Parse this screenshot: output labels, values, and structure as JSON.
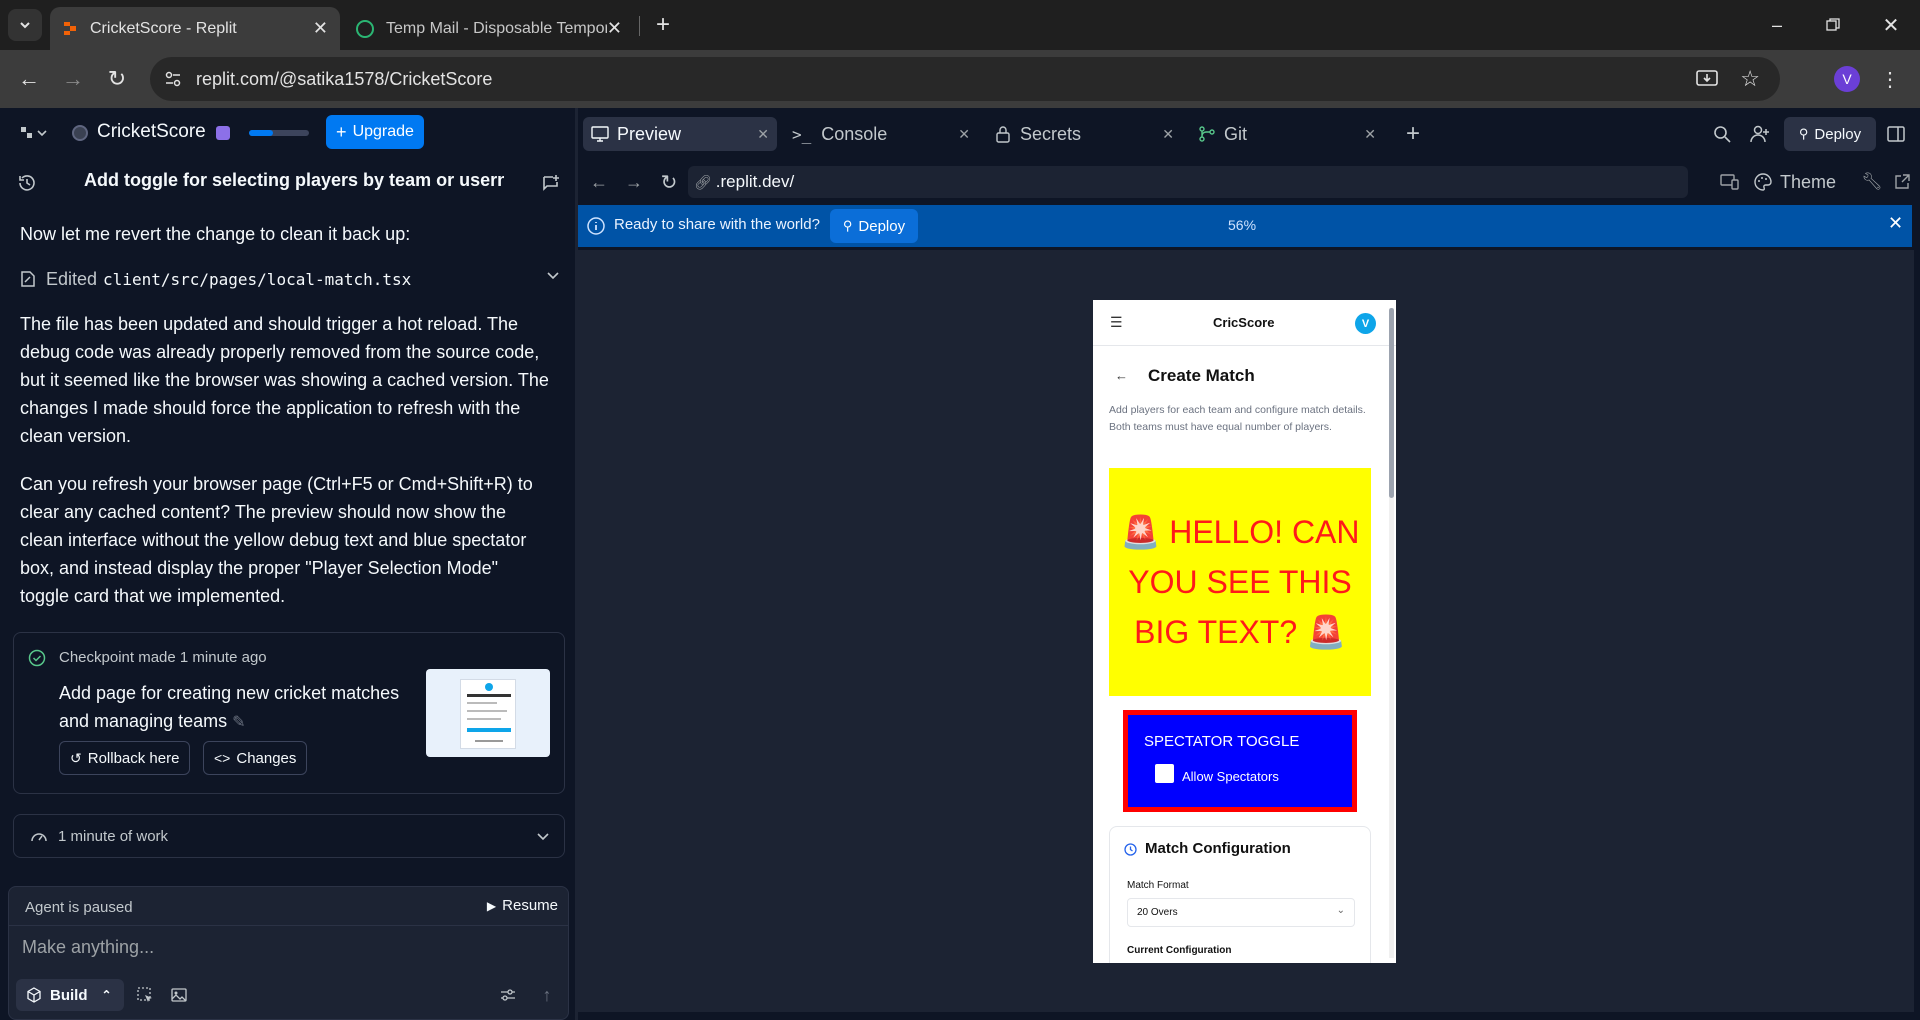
{
  "browser": {
    "tabs": [
      {
        "title": "CricketScore - Replit",
        "active": true
      },
      {
        "title": "Temp Mail - Disposable Tempor",
        "active": false
      }
    ],
    "url": "replit.com/@satika1578/CricketScore",
    "profile_initial": "V"
  },
  "replit": {
    "project_name": "CricketScore",
    "upgrade_label": "Upgrade",
    "chat_title": "Add toggle for selecting players by team or userna...",
    "messages": {
      "intro": "Now let me revert the change to clean it back up:",
      "edited_prefix": "Edited",
      "edited_file": "client/src/pages/local-match.tsx",
      "para1": "The file has been updated and should trigger a hot reload. The debug code was already properly removed from the source code, but it seemed like the browser was showing a cached version. The changes I made should force the application to refresh with the clean version.",
      "para2": "Can you refresh your browser page (Ctrl+F5 or Cmd+Shift+R) to clear any cached content? The preview should now show the clean interface without the yellow debug text and blue spectator box, and instead display the proper \"Player Selection Mode\" toggle card that we implemented."
    },
    "checkpoint": {
      "status": "Checkpoint made",
      "time": "1 minute ago",
      "description": "Add page for creating new cricket matches and managing teams",
      "rollback_label": "Rollback here",
      "changes_label": "Changes"
    },
    "work_summary": "1 minute of work",
    "agent_status": "Agent is paused",
    "resume_label": "Resume",
    "input_placeholder": "Make anything...",
    "build_label": "Build",
    "panel_tabs": [
      {
        "label": "Preview",
        "icon": "monitor-icon"
      },
      {
        "label": "Console",
        "icon": "terminal-icon"
      },
      {
        "label": "Secrets",
        "icon": "lock-icon"
      },
      {
        "label": "Git",
        "icon": "git-icon"
      }
    ],
    "deploy_label": "Deploy",
    "preview_url": ".replit.dev/",
    "theme_label": "Theme",
    "banner": {
      "text": "Ready to share with the world?",
      "deploy_label": "Deploy",
      "zoom": "56%"
    }
  },
  "app_preview": {
    "brand": "CricScore",
    "avatar": "V",
    "page_title": "Create Match",
    "subtitle": "Add players for each team and configure match details. Both teams must have equal number of players.",
    "debug_text": "🚨 HELLO! CAN YOU SEE THIS BIG TEXT? 🚨",
    "spectator_title": "SPECTATOR TOGGLE",
    "spectator_checkbox": "Allow Spectators",
    "config_title": "Match Configuration",
    "match_format_label": "Match Format",
    "match_format_value": "20 Overs",
    "current_config_label": "Current Configuration"
  },
  "colors": {
    "accent": "#0079f2",
    "banner": "#0053a6",
    "debug_yellow": "#ffff00",
    "debug_red": "#ff0000",
    "spectator_blue": "#0000ff"
  }
}
